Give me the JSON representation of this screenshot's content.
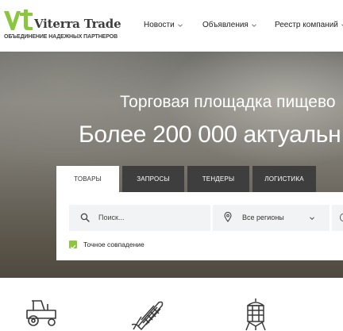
{
  "brand": {
    "name": "Viterra Trade",
    "tagline": "ОБЪЕДИНЕНИЕ НАДЕЖНЫХ ПАРТНЕРОВ",
    "colors": {
      "green": "#8cc63f",
      "dark": "#3d3d3d"
    }
  },
  "nav": {
    "items": [
      {
        "label": "Новости"
      },
      {
        "label": "Объявления"
      },
      {
        "label": "Реестр компаний"
      }
    ]
  },
  "hero": {
    "title": "Торговая площадка пищево",
    "subtitle": "Более 200 000 актуальн"
  },
  "search": {
    "tabs": [
      {
        "label": "ТОВАРЫ",
        "active": true
      },
      {
        "label": "ЗАПРОСЫ",
        "active": false
      },
      {
        "label": "ТЕНДЕРЫ",
        "active": false
      },
      {
        "label": "ЛОГИСТИКА",
        "active": false
      }
    ],
    "query_placeholder": "Поиск...",
    "region_value": "Все регионы",
    "exact_match_label": "Точное совпадение",
    "exact_match_checked": true
  },
  "categories": [
    {
      "icon": "tractor-icon"
    },
    {
      "icon": "corn-icon"
    },
    {
      "icon": "grain-elevator-icon"
    }
  ]
}
